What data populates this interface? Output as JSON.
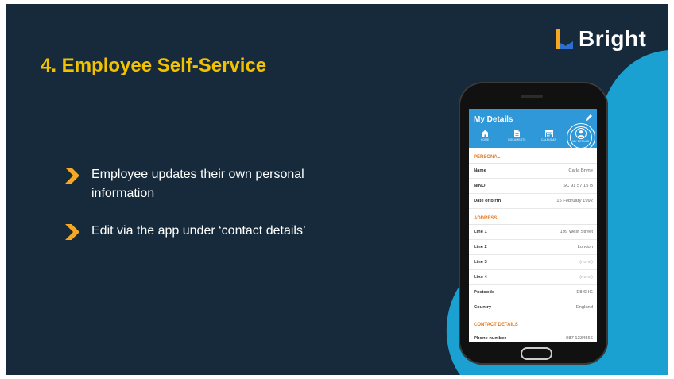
{
  "brand": {
    "name": "Bright",
    "accent": "#f2c200",
    "logo_colors": [
      "#f7a823",
      "#2b6fd4"
    ]
  },
  "slide": {
    "title": "4. Employee Self-Service",
    "bullets": [
      "Employee updates their own personal information",
      "Edit via the app under ‘contact details’"
    ]
  },
  "phone_app": {
    "header_title": "My Details",
    "nav": [
      {
        "label": "HOME",
        "icon": "home-icon"
      },
      {
        "label": "DOCUMENTS",
        "icon": "document-icon"
      },
      {
        "label": "CALENDAR",
        "icon": "calendar-icon"
      },
      {
        "label": "MY DETAILS",
        "icon": "user-icon"
      }
    ],
    "sections": [
      {
        "title": "PERSONAL",
        "rows": [
          {
            "label": "Name",
            "value": "Carla Bryne"
          },
          {
            "label": "NINO",
            "value": "SC 91 57 15 B"
          },
          {
            "label": "Date of birth",
            "value": "15 February 1992"
          }
        ]
      },
      {
        "title": "ADDRESS",
        "rows": [
          {
            "label": "Line 1",
            "value": "199 West Street"
          },
          {
            "label": "Line 2",
            "value": "London"
          },
          {
            "label": "Line 3",
            "value": "(none)"
          },
          {
            "label": "Line 4",
            "value": "(none)"
          },
          {
            "label": "Postcode",
            "value": "E8 6HG"
          },
          {
            "label": "Country",
            "value": "England"
          }
        ]
      },
      {
        "title": "CONTACT DETAILS",
        "rows": [
          {
            "label": "Phone number",
            "value": "087 1234566"
          }
        ]
      }
    ]
  }
}
